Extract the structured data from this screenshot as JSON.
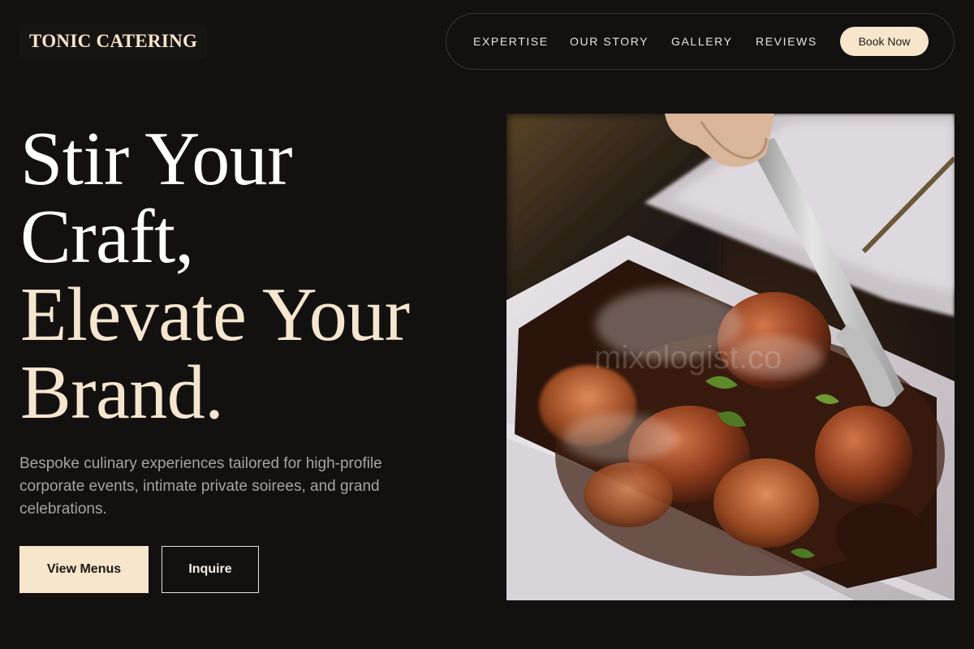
{
  "brand": {
    "name": "TONIC CATERING"
  },
  "nav": {
    "links": [
      "EXPERTISE",
      "OUR STORY",
      "GALLERY",
      "REVIEWS"
    ],
    "cta": "Book Now"
  },
  "hero": {
    "headline_lines": [
      "Stir Your",
      "Craft,",
      "Elevate Your",
      "Brand."
    ],
    "description": "Bespoke culinary experiences tailored for high-profile corporate events, intimate private soirees, and grand celebrations.",
    "primary_button": "View Menus",
    "secondary_button": "Inquire",
    "image_watermark": "mixologist.co"
  },
  "colors": {
    "background": "#131110",
    "accent_cream": "#f7e6cc",
    "body_text": "#a8a3a0"
  }
}
